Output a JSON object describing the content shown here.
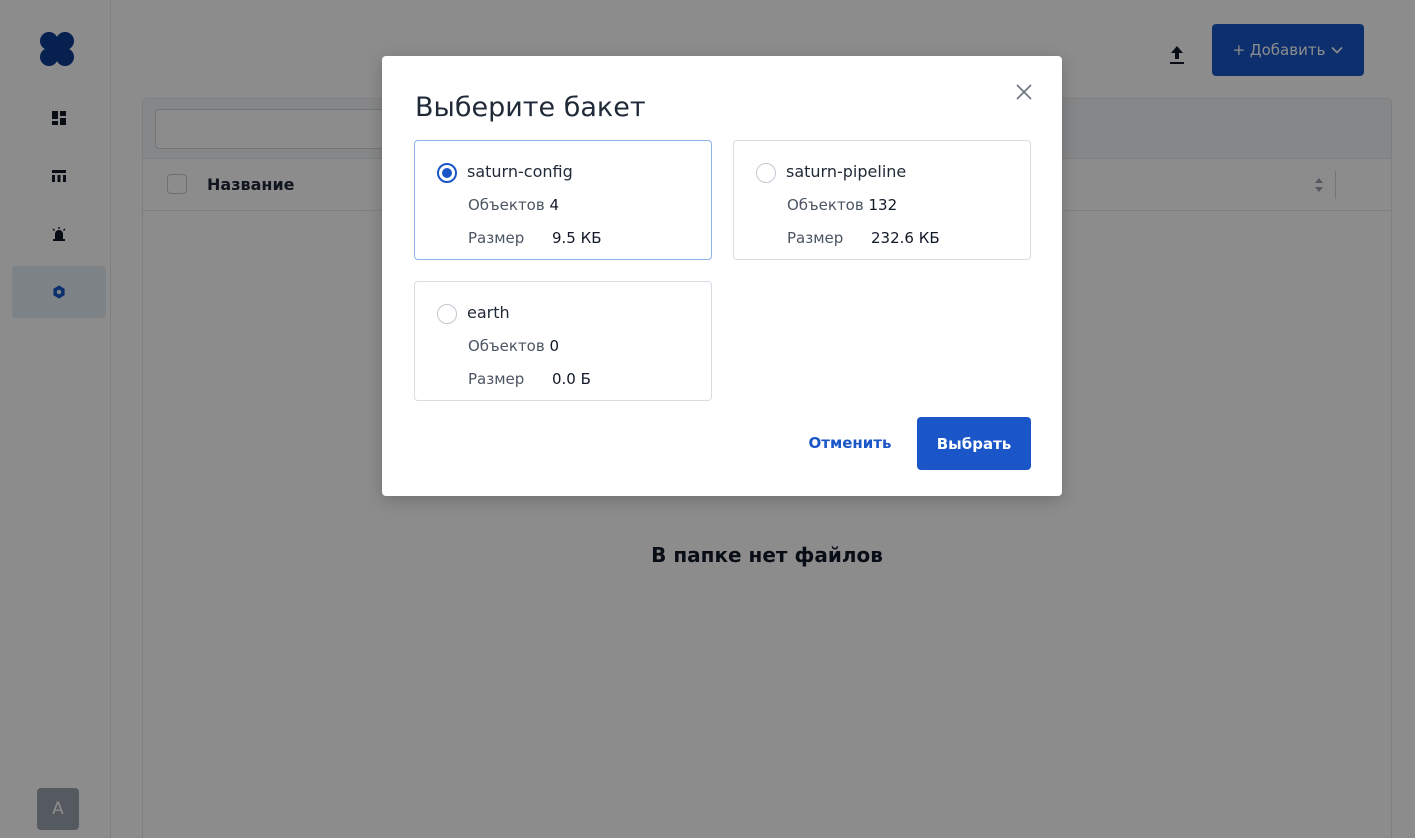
{
  "header": {
    "add_button_label": "+ Добавить",
    "add_button_chevron": "chevron-down-icon",
    "upload_icon": "upload-icon"
  },
  "sidebar": {
    "items": [
      {
        "icon": "dashboard-icon",
        "active": false
      },
      {
        "icon": "table-icon",
        "active": false
      },
      {
        "icon": "alarm-icon",
        "active": false
      },
      {
        "icon": "settings-gear-icon",
        "active": true
      }
    ],
    "avatar_letter": "A"
  },
  "table": {
    "column_name": "Название",
    "empty_message": "В папке нет файлов"
  },
  "modal": {
    "title": "Выберите бакет",
    "objects_label": "Объектов",
    "size_label": "Размер",
    "buckets": [
      {
        "name": "saturn-config",
        "objects": "4",
        "size": "9.5 КБ",
        "selected": true
      },
      {
        "name": "saturn-pipeline",
        "objects": "132",
        "size": "232.6 КБ",
        "selected": false
      },
      {
        "name": "earth",
        "objects": "0",
        "size": "0.0 Б",
        "selected": false
      }
    ],
    "cancel_label": "Отменить",
    "confirm_label": "Выбрать"
  },
  "colors": {
    "primary": "#1a56c7",
    "logo": "#0b3d91",
    "overlay": "rgba(0,0,0,0.45)"
  }
}
